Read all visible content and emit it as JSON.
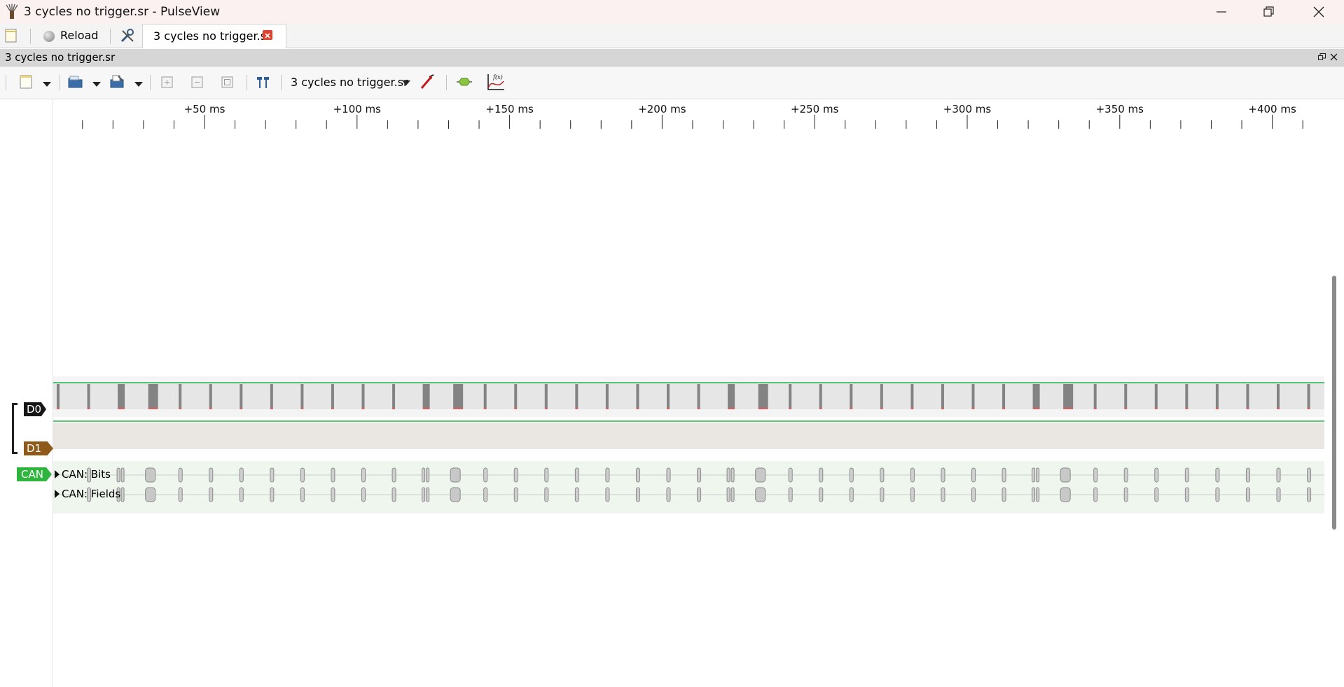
{
  "window": {
    "title": "3 cycles no trigger.sr - PulseView"
  },
  "menubar": {
    "reload_label": "Reload",
    "session_tab_label": "3 cycles no trigger.sr"
  },
  "dock": {
    "title": "3 cycles no trigger.sr"
  },
  "toolbar": {
    "device_selector": "3 cycles no trigger.sr"
  },
  "ruler": {
    "ticks": [
      "+50 ms",
      "+100 ms",
      "+150 ms",
      "+200 ms",
      "+250 ms",
      "+300 ms",
      "+350 ms",
      "+400 ms"
    ]
  },
  "channels": {
    "d0": "D0",
    "d1": "D1",
    "can": "CAN"
  },
  "decoder_rows": {
    "bits": "CAN: Bits",
    "fields": "CAN: Fields"
  },
  "colors": {
    "d0": "#161616",
    "d1": "#8f5a19",
    "can": "#2fb43e",
    "signal_high": "#22b14c",
    "edge_marker": "#e01e1e"
  },
  "icons": {
    "app": "pulseview-probe-icon",
    "new_session": "new-document-icon",
    "settings": "tools-icon",
    "open": "open-folder-icon",
    "save": "save-icon",
    "zoom_in": "zoom-in-icon",
    "zoom_out": "zoom-out-icon",
    "zoom_fit": "zoom-fit-icon",
    "cursors": "cursor-markers-icon",
    "configure": "probe-wand-icon",
    "decoder": "protocol-decoder-icon",
    "math": "math-function-icon"
  }
}
